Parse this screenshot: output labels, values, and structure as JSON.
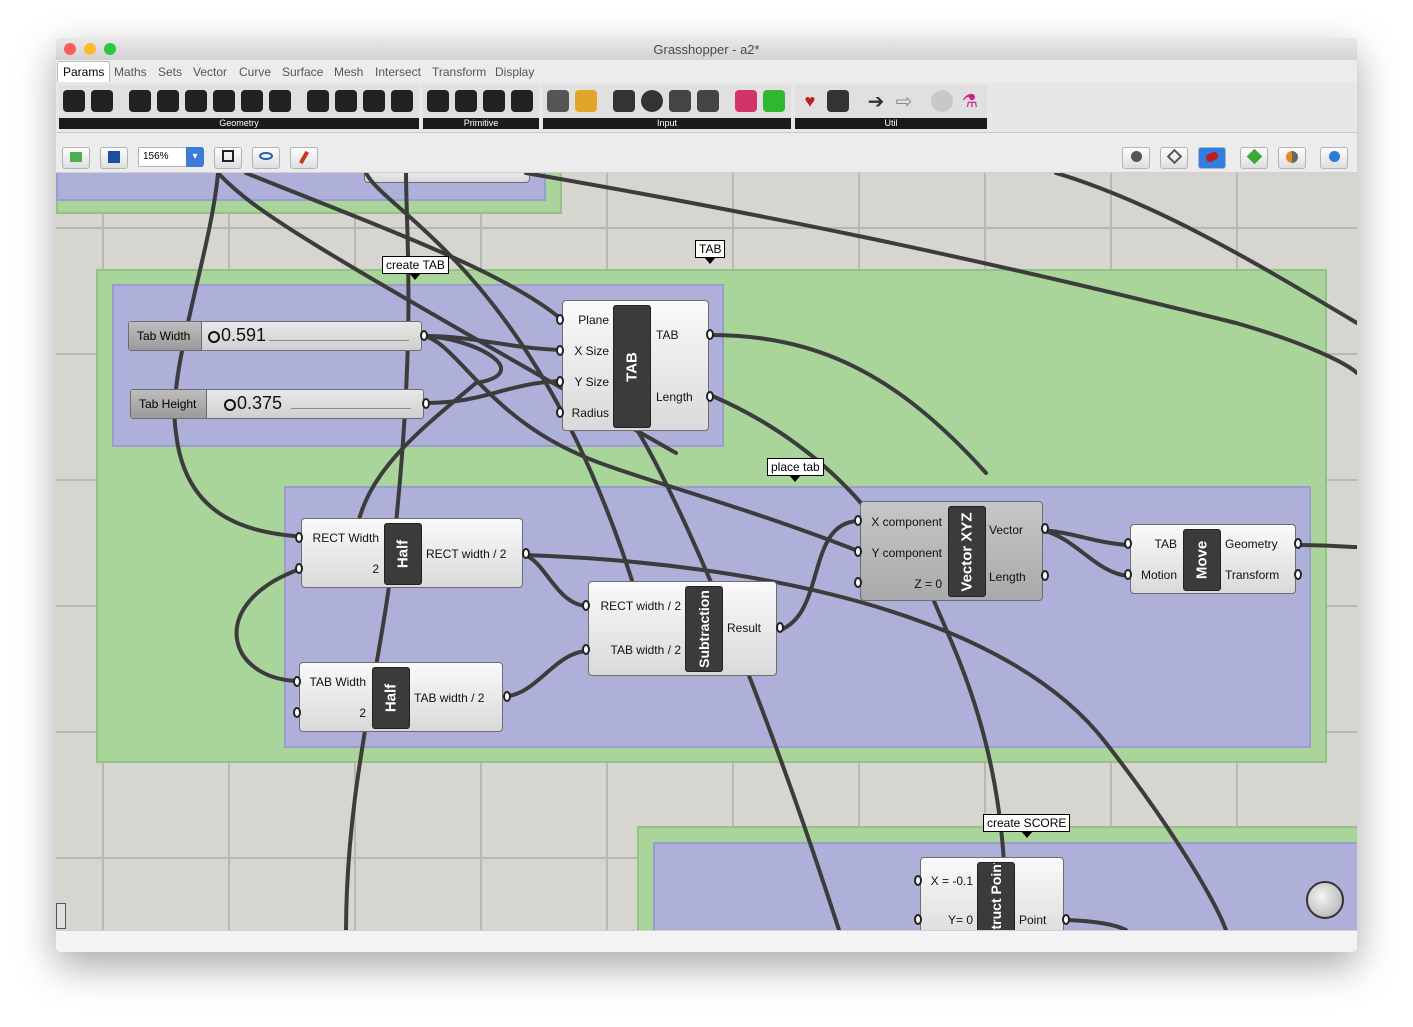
{
  "window": {
    "title": "Grasshopper - a2*"
  },
  "menu": [
    "Params",
    "Maths",
    "Sets",
    "Vector",
    "Curve",
    "Surface",
    "Mesh",
    "Intersect",
    "Transform",
    "Display"
  ],
  "ribbon": {
    "groups": [
      "Geometry",
      "Primitive",
      "Input",
      "Util"
    ]
  },
  "toolbar": {
    "zoom": "156%"
  },
  "canvas": {
    "bubbles": {
      "create_tab": "create TAB",
      "tab": "TAB",
      "place_tab": "place tab",
      "create_score": "create SCORE"
    },
    "sliders": {
      "tab_width": {
        "name": "Tab Width",
        "value": "0.591"
      },
      "tab_height": {
        "name": "Tab Height",
        "value": "0.375"
      }
    },
    "tab_comp": {
      "caption": "TAB",
      "inputs": [
        "Plane",
        "X Size",
        "Y Size",
        "Radius"
      ],
      "outputs": [
        "TAB",
        "Length"
      ]
    },
    "half1": {
      "caption": "Half",
      "inputs": [
        "RECT Width",
        "2"
      ],
      "output": "RECT width / 2"
    },
    "half2": {
      "caption": "Half",
      "inputs": [
        "TAB Width",
        "2"
      ],
      "output": "TAB width / 2"
    },
    "subtraction": {
      "caption": "Subtraction",
      "inputs": [
        "RECT width / 2",
        "TAB width / 2"
      ],
      "output": "Result"
    },
    "vector": {
      "caption": "Vector XYZ",
      "inputs": [
        "X component",
        "Y component",
        "Z = 0"
      ],
      "outputs": [
        "Vector",
        "Length"
      ]
    },
    "move": {
      "caption": "Move",
      "inputs": [
        "TAB",
        "Motion"
      ],
      "outputs": [
        "Geometry",
        "Transform"
      ]
    },
    "point": {
      "caption": "Construct Point",
      "inputs": [
        "X = -0.1",
        "Y= 0"
      ],
      "output": "Point"
    }
  }
}
